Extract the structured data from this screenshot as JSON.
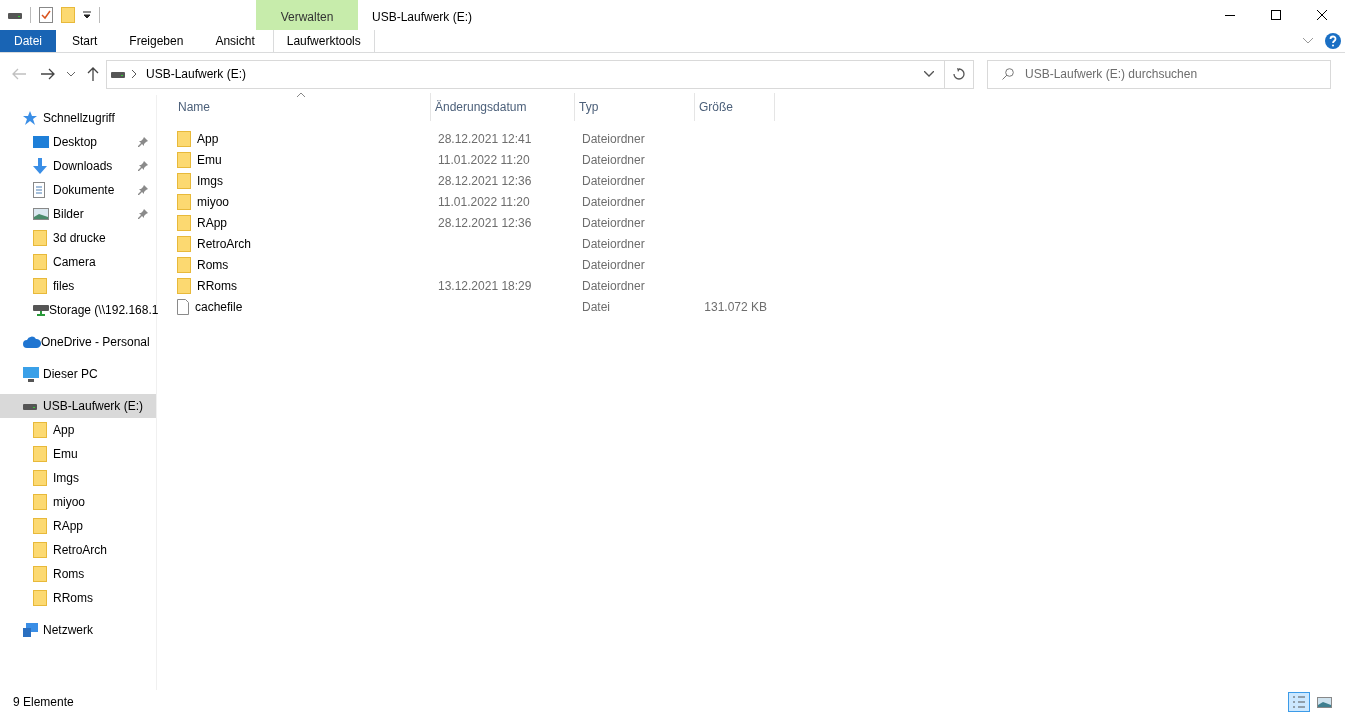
{
  "window": {
    "title": "USB-Laufwerk (E:)"
  },
  "quick_access_toolbar": {
    "context_tab": "Verwalten"
  },
  "ribbon_tabs": [
    {
      "label": "Datei",
      "kind": "file",
      "selected": false
    },
    {
      "label": "Start",
      "kind": "normal",
      "selected": false
    },
    {
      "label": "Freigeben",
      "kind": "normal",
      "selected": false
    },
    {
      "label": "Ansicht",
      "kind": "normal",
      "selected": false
    },
    {
      "label": "Laufwerktools",
      "kind": "context",
      "selected": false
    }
  ],
  "address_bar": {
    "path": "USB-Laufwerk (E:)"
  },
  "search": {
    "placeholder": "USB-Laufwerk (E:) durchsuchen"
  },
  "sidebar": [
    {
      "label": "Schnellzugriff",
      "kind": "star",
      "selected": false,
      "children": [
        {
          "label": "Desktop",
          "kind": "desktop",
          "pinned": true,
          "selected": false
        },
        {
          "label": "Downloads",
          "kind": "download",
          "pinned": true,
          "selected": false
        },
        {
          "label": "Dokumente",
          "kind": "document",
          "pinned": true,
          "selected": false
        },
        {
          "label": "Bilder",
          "kind": "pictures",
          "pinned": true,
          "selected": false
        },
        {
          "label": "3d drucke",
          "kind": "folder",
          "pinned": false,
          "selected": false
        },
        {
          "label": "Camera",
          "kind": "folder",
          "pinned": false,
          "selected": false
        },
        {
          "label": "files",
          "kind": "folder",
          "pinned": false,
          "selected": false
        },
        {
          "label": "Storage (\\\\192.168.1",
          "kind": "netdrive",
          "pinned": false,
          "selected": false
        }
      ]
    },
    {
      "label": "OneDrive - Personal",
      "kind": "cloud",
      "selected": false
    },
    {
      "label": "Dieser PC",
      "kind": "pc",
      "selected": false
    },
    {
      "label": "USB-Laufwerk (E:)",
      "kind": "drive",
      "selected": true,
      "children": [
        {
          "label": "App",
          "kind": "folder",
          "pinned": false,
          "selected": false
        },
        {
          "label": "Emu",
          "kind": "folder",
          "pinned": false,
          "selected": false
        },
        {
          "label": "Imgs",
          "kind": "folder",
          "pinned": false,
          "selected": false
        },
        {
          "label": "miyoo",
          "kind": "folder",
          "pinned": false,
          "selected": false
        },
        {
          "label": "RApp",
          "kind": "folder",
          "pinned": false,
          "selected": false
        },
        {
          "label": "RetroArch",
          "kind": "folder",
          "pinned": false,
          "selected": false
        },
        {
          "label": "Roms",
          "kind": "folder",
          "pinned": false,
          "selected": false
        },
        {
          "label": "RRoms",
          "kind": "folder",
          "pinned": false,
          "selected": false
        }
      ]
    },
    {
      "label": "Netzwerk",
      "kind": "network",
      "selected": false
    }
  ],
  "table": {
    "columns": [
      "Name",
      "Änderungsdatum",
      "Typ",
      "Größe"
    ],
    "rows": [
      {
        "kind": "folder",
        "name": "App",
        "date": "28.12.2021 12:41",
        "type": "Dateiordner"
      },
      {
        "kind": "folder",
        "name": "Emu",
        "date": "11.01.2022 11:20",
        "type": "Dateiordner"
      },
      {
        "kind": "folder",
        "name": "Imgs",
        "date": "28.12.2021 12:36",
        "type": "Dateiordner"
      },
      {
        "kind": "folder",
        "name": "miyoo",
        "date": "11.01.2022 11:20",
        "type": "Dateiordner"
      },
      {
        "kind": "folder",
        "name": "RApp",
        "date": "28.12.2021 12:36",
        "type": "Dateiordner"
      },
      {
        "kind": "folder",
        "name": "RetroArch",
        "type": "Dateiordner"
      },
      {
        "kind": "folder",
        "name": "Roms",
        "type": "Dateiordner"
      },
      {
        "kind": "folder",
        "name": "RRoms",
        "date": "13.12.2021 18:29",
        "type": "Dateiordner"
      },
      {
        "kind": "file",
        "name": "cachefile",
        "type": "Datei",
        "size": "131.072 KB"
      }
    ]
  },
  "status_bar": {
    "count": "9 Elemente",
    "view_buttons": [
      {
        "kind": "details",
        "selected": true
      },
      {
        "kind": "tiles",
        "selected": false
      }
    ]
  }
}
